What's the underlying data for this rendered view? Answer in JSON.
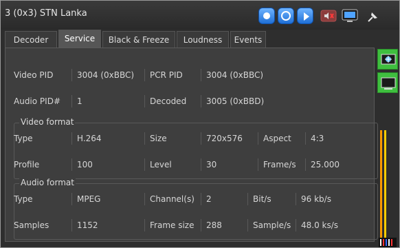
{
  "window": {
    "title": "3 (0x3) STN Lanka"
  },
  "tabs": [
    "Decoder",
    "Service",
    "Black & Freeze",
    "Loudness",
    "Events"
  ],
  "active_tab": "Service",
  "service": {
    "rows": [
      [
        "Video PID",
        "3004 (0xBBC)",
        "PCR PID",
        "3004 (0xBBC)"
      ],
      [
        "Audio PID#",
        "1",
        "Decoded",
        "3005 (0xBBD)"
      ]
    ]
  },
  "video_format": {
    "label": "Video format",
    "rows": [
      [
        "Type",
        "H.264",
        "Size",
        "720x576",
        "Aspect",
        "4:3"
      ],
      [
        "Profile",
        "100",
        "Level",
        "30",
        "Frame/s",
        "25.000"
      ]
    ]
  },
  "audio_format": {
    "label": "Audio format",
    "rows": [
      [
        "Type",
        "MPEG",
        "Channel(s)",
        "2",
        "Bit/s",
        "96 kb/s"
      ],
      [
        "Samples",
        "1152",
        "Frame size",
        "288",
        "Sample/s",
        "48.0 ks/s"
      ]
    ]
  },
  "icons": {
    "toolbar": [
      "stop-icon",
      "record-icon",
      "play-icon",
      "mute-icon",
      "monitor-icon",
      "pin-icon"
    ],
    "side": [
      "display-settings-icon",
      "screen-icon"
    ]
  },
  "colors": {
    "accent_blue": "#2f86ff",
    "green": "#3fbf3f",
    "meter_colors": [
      "#ff9900",
      "#ffcc00",
      "#ffffff",
      "#ff3333",
      "#3366ff"
    ]
  }
}
